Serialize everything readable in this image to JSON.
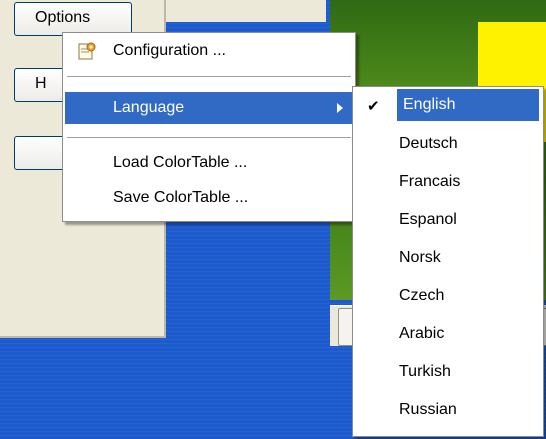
{
  "app": {
    "options_button_label": "Options",
    "second_button_label": "H",
    "third_button_label": ""
  },
  "options_menu": {
    "items": [
      {
        "label": "Configuration ...",
        "icon": "configuration-icon"
      },
      {
        "label": "Language",
        "has_submenu": true,
        "highlighted": true
      },
      {
        "label": "Load ColorTable ..."
      },
      {
        "label": "Save ColorTable ..."
      }
    ]
  },
  "language_submenu": {
    "selected": "English",
    "items": [
      {
        "label": "English",
        "checked": true
      },
      {
        "label": "Deutsch"
      },
      {
        "label": "Francais"
      },
      {
        "label": "Espanol"
      },
      {
        "label": "Norsk"
      },
      {
        "label": "Czech"
      },
      {
        "label": "Arabic"
      },
      {
        "label": "Turkish"
      },
      {
        "label": "Russian"
      }
    ]
  },
  "colors": {
    "highlight": "#316ac5",
    "desktop_blue": "#1e5acb",
    "menu_bg": "#ffffff"
  }
}
